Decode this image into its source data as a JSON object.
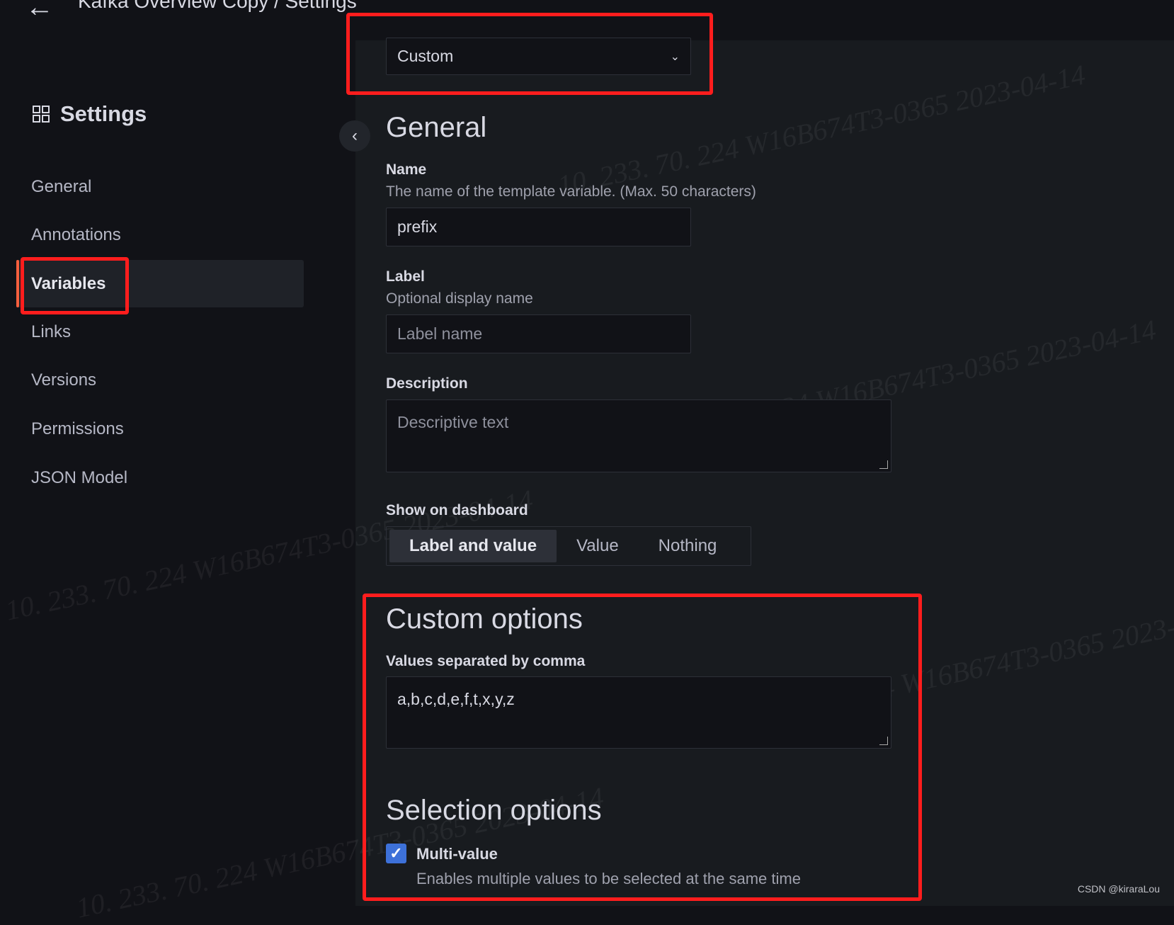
{
  "header": {
    "title": "Kafka Overview Copy / Settings"
  },
  "sidebar": {
    "heading": "Settings",
    "items": [
      {
        "label": "General"
      },
      {
        "label": "Annotations"
      },
      {
        "label": "Variables",
        "active": true
      },
      {
        "label": "Links"
      },
      {
        "label": "Versions"
      },
      {
        "label": "Permissions"
      },
      {
        "label": "JSON Model"
      }
    ]
  },
  "form": {
    "type_select": {
      "value": "Custom"
    },
    "general_heading": "General",
    "name": {
      "label": "Name",
      "description": "The name of the template variable. (Max. 50 characters)",
      "value": "prefix"
    },
    "label": {
      "label": "Label",
      "description": "Optional display name",
      "placeholder": "Label name"
    },
    "description": {
      "label": "Description",
      "placeholder": "Descriptive text"
    },
    "show_on_dashboard": {
      "label": "Show on dashboard",
      "options": [
        "Label and value",
        "Value",
        "Nothing"
      ],
      "selected": "Label and value"
    },
    "custom_heading": "Custom options",
    "values": {
      "label": "Values separated by comma",
      "value": "a,b,c,d,e,f,t,x,y,z"
    },
    "selection_heading": "Selection options",
    "multi_value": {
      "label": "Multi-value",
      "description": "Enables multiple values to be selected at the same time",
      "checked": true
    }
  },
  "watermark": "10. 233. 70. 224 W16B674T3-0365 2023-04-14",
  "credit": "CSDN @kiraraLou",
  "colors": {
    "accent": "#f55f3e",
    "highlight": "#ff1d1d",
    "checkbox": "#3d71d9"
  }
}
